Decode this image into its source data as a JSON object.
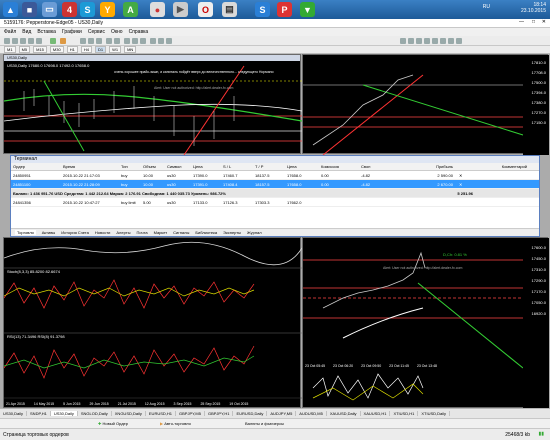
{
  "taskbar": {
    "clock": "18:14",
    "date": "23.10.2015",
    "lang": "RU"
  },
  "titlebar": {
    "title": "5159176: Pepperstone-Edge05 - US30,Daily"
  },
  "menu": [
    "Файл",
    "Вид",
    "Вставка",
    "Графики",
    "Сервис",
    "Окно",
    "Справка"
  ],
  "timeframes": [
    "M1",
    "M5",
    "M15",
    "M30",
    "H1",
    "H4",
    "D1",
    "W1",
    "MN"
  ],
  "charts": {
    "top_left_title": "US30,Daily",
    "top_left_ohlc": "US30,Daily 17680.0 17698.0 17492.0 17658.0",
    "annotation_1": "очень хорошее прайс-экшн, и капиталь пойдёт вверх до величественного... следующего Нормано",
    "annotation_2": "Alert: User not authorized: http://alert.dealer-fx.com",
    "bottom_stoch": "Stoch(8,3,3) 85.8200 82.6674",
    "bottom_rsi": "RSI(13) 71.3496 RSI(8) 91.3798",
    "right_label": "D,Ch: 0.81 %",
    "right_annotation": "Alert: User not authorized: http://alert.dealer-fx.com",
    "price_levels_top": [
      "17810.0",
      "17708.0",
      "17500.0",
      "17394.0",
      "17380.0",
      "17270.0",
      "17150.0"
    ],
    "price_levels_bottom": [
      "17600.0",
      "17450.0",
      "17310.0",
      "17290.0",
      "17170.0",
      "17050.0",
      "16920.0"
    ],
    "dates_left": [
      "21 Apr 2015",
      "14 May 2015",
      "5 Jun 2015",
      "29 Jun 2015",
      "21 Jul 2015",
      "12 Aug 2015",
      "3 Sep 2015",
      "25 Sep 2015",
      "19 Oct 2015"
    ],
    "dates_right": [
      "23 Oct 05:45",
      "23 Oct 06:20",
      "23 Oct 09:50",
      "23 Oct 11:45",
      "23 Oct 13:48"
    ]
  },
  "terminal": {
    "title": "Терминал",
    "columns": [
      "Ордер",
      "Время",
      "Тип",
      "Объем",
      "Символ",
      "Цена",
      "S / L",
      "T / P",
      "Цена",
      "Комиссия",
      "Своп",
      "Прибыль",
      "Комментарий"
    ],
    "rows": [
      {
        "order": "24850951",
        "time": "2015.10.22 21:17:03",
        "type": "buy",
        "volume": "10.00",
        "symbol": "us30",
        "price": "17390.0",
        "sl": "17460.7",
        "tp": "18137.5",
        "cur": "17658.0",
        "comm": "0.00",
        "swap": "-4.82",
        "profit": "2 590.00"
      },
      {
        "order": "24851100",
        "time": "2015.10.22 21:28:09",
        "type": "buy",
        "volume": "10.00",
        "symbol": "us30",
        "price": "17391.0",
        "sl": "17408.4",
        "tp": "18157.5",
        "cur": "17658.0",
        "comm": "0.00",
        "swap": "-4.82",
        "profit": "2 670.00"
      }
    ],
    "balance_row": "Баланс: 1 436 951.76 USD  Средства: 1 442 212.64  Маржа: 2 176.91  Свободная: 1 440 035.73  Уровень: 986.72%",
    "balance_total": "5 251.96",
    "pending_row": {
      "order": "24841356",
      "time": "2015.10.22 10:47:27",
      "type": "buy limit",
      "volume": "5.00",
      "symbol": "us30",
      "price": "17133.0",
      "sl": "17126.3",
      "tp": "17303.3",
      "cur": "17662.0"
    },
    "tabs": [
      "Торговля",
      "Активы",
      "История Счета",
      "Новости",
      "Алерты",
      "Почта",
      "Маркет",
      "Сигналы",
      "Библиотека",
      "Эксперты",
      "Журнал"
    ]
  },
  "chart_tabs": [
    "US30,Daily",
    "SNDP,H1",
    "US30,Daily",
    "SNGLOD,Daily",
    "XNGUSD,Daily",
    "EURUSD,H1",
    "GBPJPY,M5",
    "GBPJPY,H1",
    "EURUSD,Daily",
    "AUDJPY,M5",
    "AUDUSD,M5",
    "XAUUSD,Daily",
    "XAUUSD,H1",
    "XTIUSD,H1",
    "XTIUSD,Daily"
  ],
  "bottom": {
    "new_order": "Новый Ордер",
    "auto_trade": "Авто-торговля",
    "expert": "Валюты и фьючерсы"
  },
  "status": {
    "left": "Страница торговых ордеров",
    "right": "25468/3 kb"
  }
}
